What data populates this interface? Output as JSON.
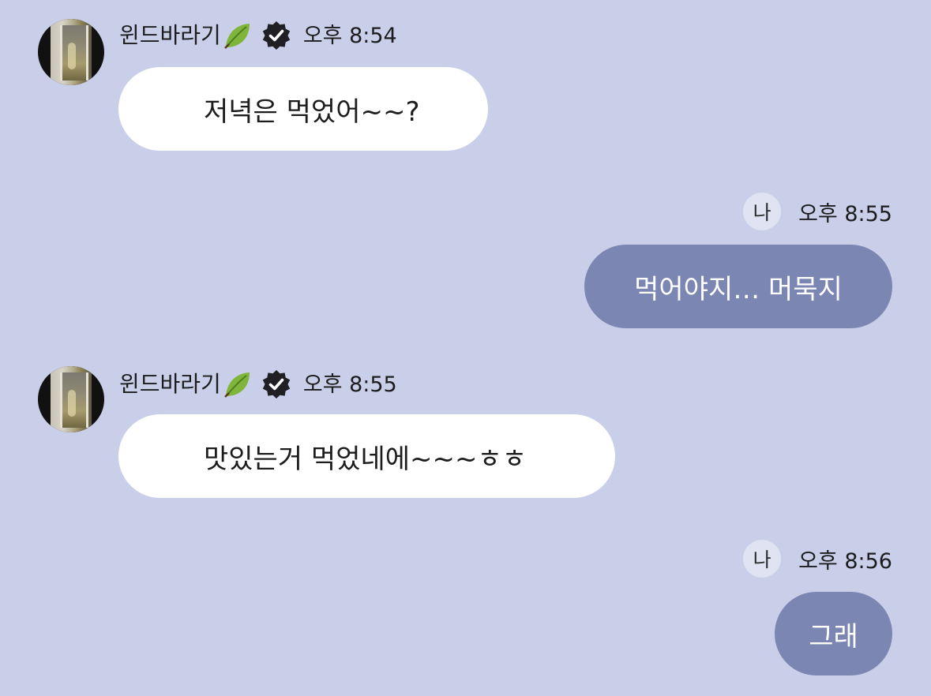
{
  "colors": {
    "background": "#c9cfe8",
    "incoming_bubble": "#ffffff",
    "outgoing_bubble": "#7b86b2",
    "me_badge": "#dfe3f2"
  },
  "messages": [
    {
      "direction": "incoming",
      "sender": "윈드바라기",
      "sender_icons": [
        "leaf-icon",
        "verified-badge-icon"
      ],
      "time": "오후 8:54",
      "text": "저녁은 먹었어~~?"
    },
    {
      "direction": "outgoing",
      "sender_badge": "나",
      "time": "오후 8:55",
      "text": "먹어야지… 머묵지"
    },
    {
      "direction": "incoming",
      "sender": "윈드바라기",
      "sender_icons": [
        "leaf-icon",
        "verified-badge-icon"
      ],
      "time": "오후 8:55",
      "text": "맛있는거 먹었네에~~~ㅎㅎ"
    },
    {
      "direction": "outgoing",
      "sender_badge": "나",
      "time": "오후 8:56",
      "text": "그래"
    }
  ]
}
